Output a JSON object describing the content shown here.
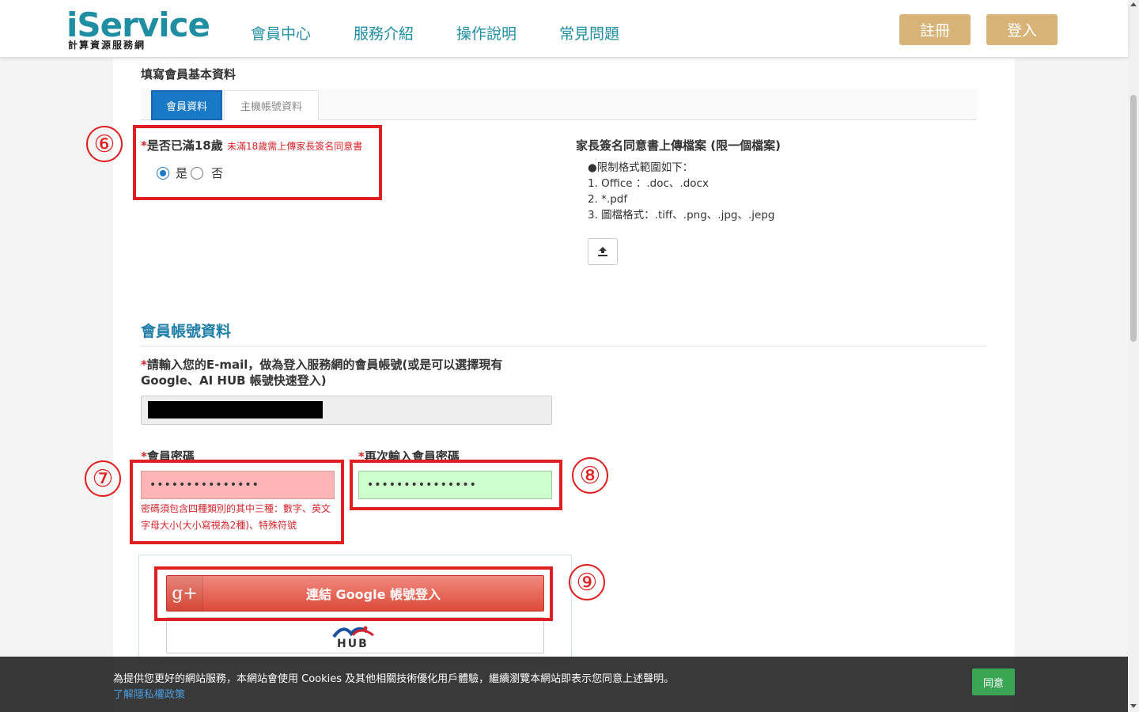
{
  "header": {
    "logo_main": "iService",
    "logo_sub": "計算資源服務網",
    "nav": [
      "會員中心",
      "服務介紹",
      "操作說明",
      "常見問題"
    ],
    "register_label": "註冊",
    "login_label": "登入"
  },
  "form": {
    "section_heading": "填寫會員基本資料",
    "tabs": [
      "會員資料",
      "主機帳號資料"
    ],
    "age_question": "是否已滿18歲",
    "age_hint": "未滿18歲需上傳家長簽名同意書",
    "radio_yes": "是",
    "radio_no": "否",
    "upload_title": "家長簽名同意書上傳檔案 (限一個檔案)",
    "upload_rules": [
      "●限制格式範圍如下：",
      "1. Office ：.doc、.docx",
      "2. *.pdf",
      "3. 圖檔格式：.tiff、.png、.jpg、.jepg"
    ],
    "account_title": "會員帳號資料",
    "email_label": "請輸入您的E-mail，做為登入服務網的會員帳號(或是可以選擇現有Google、AI HUB 帳號快速登入)",
    "password_label": "會員密碼",
    "password_value": "•••••••••••••••",
    "confirm_label": "再次輸入會員密碼",
    "confirm_value": "•••••••••••••••",
    "password_hint": "密碼須包含四種類別的其中三種：數字、英文字母大小(大小寫視為2種)、特殊符號",
    "google_label": "連結 Google 帳號登入",
    "google_icon": "g+",
    "aihub_label": "HUB",
    "required_mark": "*"
  },
  "annotations": [
    "⑥",
    "⑦",
    "⑧",
    "⑨"
  ],
  "cookie": {
    "text": "為提供您更好的網站服務，本網站會使用 Cookies 及其他相關技術優化用戶體驗，繼續瀏覽本網站即表示您同意上述聲明。",
    "link": "了解隱私權政策",
    "agree": "同意"
  },
  "colors": {
    "brand": "#1f8ea3",
    "accent_button": "#d8b377",
    "tab_active": "#1a79c7",
    "error": "#d9232a",
    "google": "#dd4b39",
    "agree": "#3aa655"
  }
}
